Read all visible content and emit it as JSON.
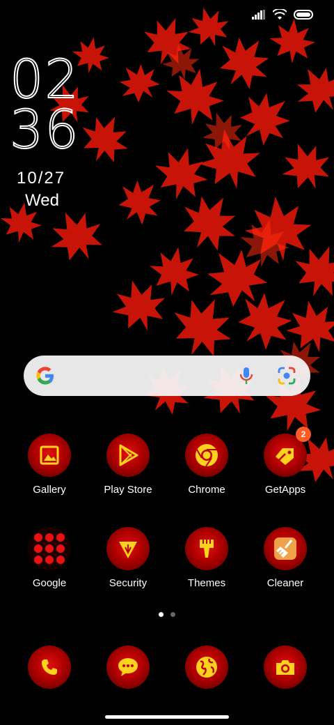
{
  "status_bar": {
    "signal_icon": "signal-icon",
    "wifi_icon": "wifi-icon",
    "battery_icon": "battery-icon"
  },
  "clock": {
    "hours": "02",
    "minutes": "36",
    "date": "10/27",
    "day": "Wed"
  },
  "search_bar": {
    "logo": "google-g-icon",
    "mic_icon": "mic-icon",
    "lens_icon": "lens-icon"
  },
  "apps_row1": [
    {
      "label": "Gallery",
      "icon": "image-icon"
    },
    {
      "label": "Play Store",
      "icon": "play-icon"
    },
    {
      "label": "Chrome",
      "icon": "chrome-icon"
    },
    {
      "label": "GetApps",
      "icon": "tag-icon",
      "badge": "2"
    }
  ],
  "apps_row2": [
    {
      "label": "Google",
      "icon": "folder-icon"
    },
    {
      "label": "Security",
      "icon": "shield-icon"
    },
    {
      "label": "Themes",
      "icon": "brush-icon"
    },
    {
      "label": "Cleaner",
      "icon": "broom-icon"
    }
  ],
  "dock": [
    {
      "icon": "phone-icon"
    },
    {
      "icon": "messages-icon"
    },
    {
      "icon": "browser-globe-icon"
    },
    {
      "icon": "camera-icon"
    }
  ],
  "page_indicator": {
    "pages": 2,
    "current": 1
  },
  "colors": {
    "accent": "#e01010",
    "icon_fg": "#ffd21e",
    "badge": "#ff5a24"
  }
}
